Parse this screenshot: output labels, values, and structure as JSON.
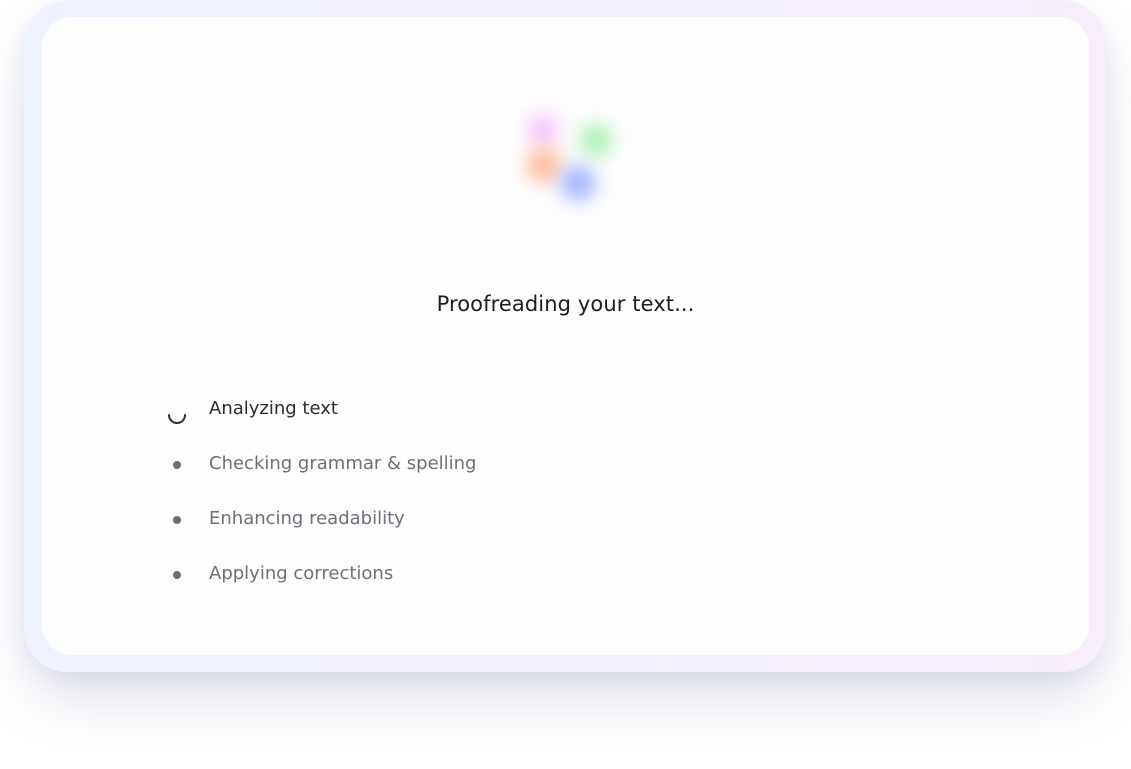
{
  "title": "Proofreading your text...",
  "logo": {
    "icon": "multicolor-blob-logo-icon"
  },
  "steps": [
    {
      "label": "Analyzing text",
      "status": "active",
      "icon": "spinner-icon"
    },
    {
      "label": "Checking grammar & spelling",
      "status": "pending",
      "icon": "bullet-icon"
    },
    {
      "label": "Enhancing readability",
      "status": "pending",
      "icon": "bullet-icon"
    },
    {
      "label": "Applying corrections",
      "status": "pending",
      "icon": "bullet-icon"
    }
  ],
  "colors": {
    "logo_purple": "#f2b6ff",
    "logo_green": "#a9f0b0",
    "logo_orange": "#ffb28d",
    "logo_blue": "#9bb0ff"
  }
}
